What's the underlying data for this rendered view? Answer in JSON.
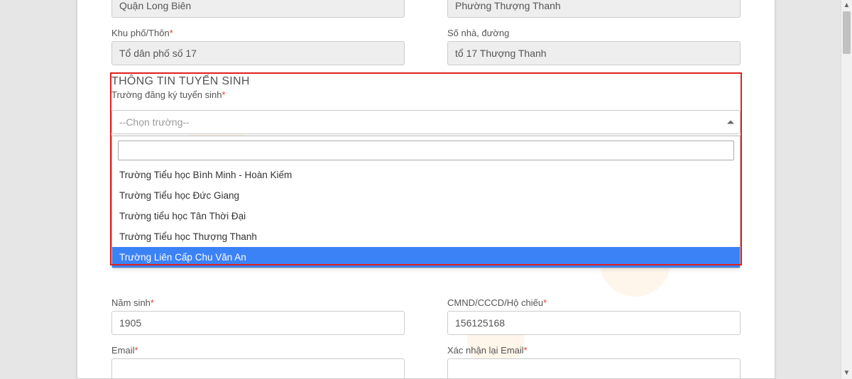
{
  "top": {
    "district_value": "Quận Long Biên",
    "ward_value": "Phường Thượng Thanh",
    "street_block_label": "Khu phố/Thôn",
    "street_block_value": "Tổ dân phố số 17",
    "house_label": "Số nhà, đường",
    "house_value": "tổ 17 Thượng Thanh"
  },
  "enroll": {
    "section_title": "THÔNG TIN TUYỂN SINH",
    "school_label": "Trường đăng ký tuyển sinh",
    "select_placeholder": "--Chọn trường--",
    "options": [
      "Trường Tiểu học Bình Minh - Hoàn Kiếm",
      "Trường Tiểu học Đức Giang",
      "Trường tiểu học Tân Thời Đại",
      "Trường Tiểu học Thượng Thanh",
      "Trường Liên Cấp Chu Văn An"
    ],
    "highlight_index": 4
  },
  "parent": {
    "birthyear_label": "Năm sinh",
    "birthyear_value": "1905",
    "id_label": "CMND/CCCD/Hộ chiếu",
    "id_value": "156125168",
    "email_label": "Email",
    "email_confirm_label": "Xác nhận lại Email"
  }
}
